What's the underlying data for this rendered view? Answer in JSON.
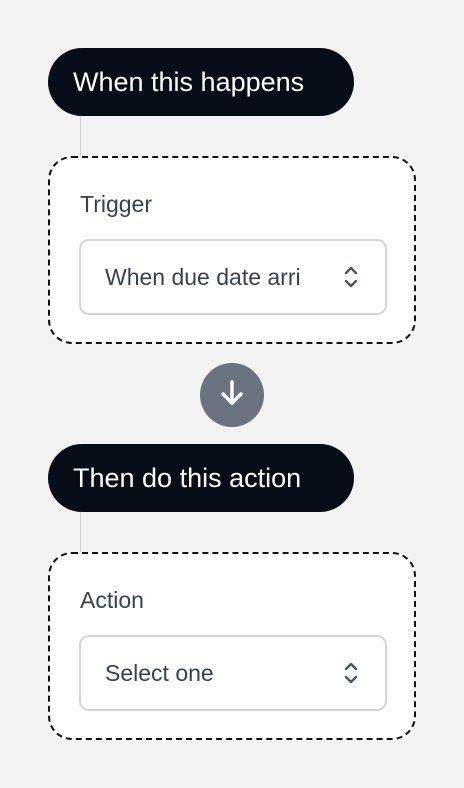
{
  "trigger_section": {
    "heading": "When this happens",
    "label": "Trigger",
    "select_value": "When due date arri",
    "chevrons_icon": "chevron-up-down-icon"
  },
  "flow_arrow": {
    "icon": "arrow-down-icon",
    "color": "#6b7280"
  },
  "action_section": {
    "heading": "Then do this action",
    "label": "Action",
    "select_value": "Select one",
    "chevrons_icon": "chevron-up-down-icon"
  },
  "colors": {
    "pill_background": "#070d16",
    "page_background": "#f3f3f3"
  }
}
